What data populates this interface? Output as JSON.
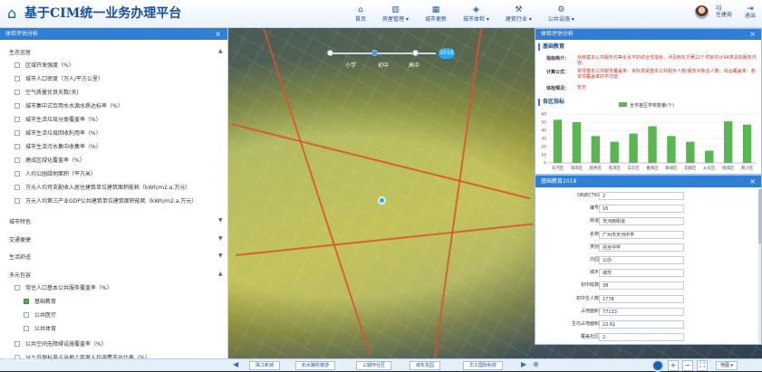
{
  "header": {
    "app_title": "基于CIM统一业务办理平台",
    "nav": [
      {
        "label": "首页",
        "icon": "home-icon"
      },
      {
        "label": "房屋管理",
        "icon": "building-icon",
        "dropdown": true
      },
      {
        "label": "城市更新",
        "icon": "city-icon"
      },
      {
        "label": "城市体检",
        "icon": "checkup-icon",
        "dropdown": true
      },
      {
        "label": "建筑行业",
        "icon": "construction-icon",
        "dropdown": true
      },
      {
        "label": "公共设施",
        "icon": "facility-icon",
        "dropdown": true
      }
    ],
    "user": {
      "name_line1": "zjj",
      "name_line2": "住建局"
    },
    "logout_label": "退出"
  },
  "timeline": {
    "labels": [
      "小学",
      "初中",
      "高中"
    ],
    "year": "2018"
  },
  "left_panel": {
    "title": "体检评估分析",
    "groups": [
      {
        "label": "生态宜居",
        "items": [
          {
            "label": "区域开发强度（%）",
            "checked": false
          },
          {
            "label": "城市人口密度（万人/平方公里）",
            "checked": false
          },
          {
            "label": "空气质量优良天数(天)",
            "checked": false
          },
          {
            "label": "城市集中式饮用水水源水质达标率（%）",
            "checked": false
          },
          {
            "label": "城市生活垃圾分类覆盖率（%）",
            "checked": false
          },
          {
            "label": "城市生活垃圾回收利用率（%）",
            "checked": false
          },
          {
            "label": "城市生活污水集中收集率（%）",
            "checked": false
          },
          {
            "label": "建成区绿化覆盖率（%）",
            "checked": false
          },
          {
            "label": "人均公园绿地面积（平方米）",
            "checked": false
          },
          {
            "label": "万元人均可支配收入居住建筑单位建筑面积能耗（kWh/m2.a.万元）",
            "checked": false
          },
          {
            "label": "万元人均第三产业GDP公共建筑单位建筑面积能耗（kWh/m2.a.万元）",
            "checked": false
          }
        ]
      },
      {
        "label": "城市特色",
        "items": []
      },
      {
        "label": "交通便捷",
        "items": []
      },
      {
        "label": "生活舒适",
        "items": []
      },
      {
        "label": "多元包容",
        "items": [
          {
            "label": "常住人口基本公共服务覆盖率（%）",
            "checked": false,
            "expanded": true,
            "children": [
              {
                "label": "基础教育",
                "checked": true
              },
              {
                "label": "公共医疗",
                "checked": false
              },
              {
                "label": "公共体育",
                "checked": false
              }
            ]
          },
          {
            "label": "公共空间无障碍设施覆盖率（%）",
            "checked": false
          },
          {
            "label": "城乡低保标准占当地上年度人均消费支出比率（%）",
            "checked": false
          }
        ]
      }
    ]
  },
  "right_panel": {
    "title": "体检评估分析",
    "section_title": "基础教育",
    "info": [
      {
        "key": "指标简介：",
        "value": "反映基本公共服务均等化水平的综合性指标，涉及到东方著22个项目共计94类具体服务内容。"
      },
      {
        "key": "计算公式：",
        "value": "单项基本公共服务覆盖率：实际享受基本公共服务人数/服务对象总人数；综合覆盖率：各单项覆盖率的平均值"
      },
      {
        "key": "体检情况：",
        "value": "暂无"
      }
    ],
    "chart_section_title": "各区指标"
  },
  "chart_data": {
    "type": "bar",
    "legend": "全市各区学校数量(个)",
    "categories": [
      "天河区",
      "海珠区",
      "越秀区",
      "荔湾区",
      "白云区",
      "番禺区",
      "黄埔区",
      "花都区",
      "从化区",
      "增城区",
      "南沙区"
    ],
    "values": [
      53,
      50,
      33,
      26,
      36,
      45,
      33,
      26,
      15,
      51,
      47
    ],
    "ylim": [
      0,
      60
    ],
    "yticks": [
      0,
      10,
      20,
      30,
      40,
      50,
      60
    ],
    "bar_color": "#5ab552"
  },
  "attr_panel": {
    "title": "基础教育2018",
    "rows": [
      {
        "key": "OBJECTID：",
        "value": "2"
      },
      {
        "key": "编号：",
        "value": "16"
      },
      {
        "key": "街道：",
        "value": "天河南街道"
      },
      {
        "key": "名称：",
        "value": "广州市天河中学"
      },
      {
        "key": "类别：",
        "value": "完全中学"
      },
      {
        "key": "办园：",
        "value": "公办"
      },
      {
        "key": "城乡：",
        "value": "城市"
      },
      {
        "key": "初中班数：",
        "value": "38"
      },
      {
        "key": "初中生人数：",
        "value": "1778"
      },
      {
        "key": "占地面积：",
        "value": "77133"
      },
      {
        "key": "生均占地面积：",
        "value": "22.61"
      },
      {
        "key": "覆盖社区：",
        "value": "2"
      }
    ]
  },
  "bottom_bar": {
    "buttons": [
      "珠江新城",
      "石水路所楼游",
      "三期环社区",
      "城东花园",
      "华工国际科技"
    ],
    "map_type": "地图"
  },
  "watermark": "@ 无忧吧"
}
